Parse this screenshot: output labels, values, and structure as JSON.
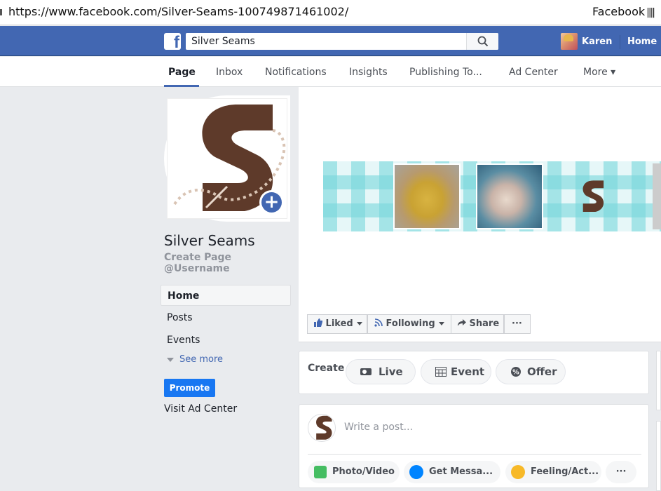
{
  "browser": {
    "url": "https://www.facebook.com/Silver-Seams-100749871461002/",
    "tab_title": "Facebook"
  },
  "topbar": {
    "logo_icon": "facebook-f-icon",
    "search_value": "Silver Seams",
    "search_icon": "search-icon",
    "user_name": "Karen",
    "home_label": "Home",
    "brand_color": "#4267b2"
  },
  "tabs": [
    {
      "label": "Page",
      "active": true
    },
    {
      "label": "Inbox"
    },
    {
      "label": "Notifications"
    },
    {
      "label": "Insights"
    },
    {
      "label": "Publishing To..."
    },
    {
      "label": "Ad Center"
    },
    {
      "label": "More ▾"
    }
  ],
  "profile": {
    "page_name": "Silver Seams",
    "create_username_line1": "Create Page",
    "create_username_line2": "@Username"
  },
  "left_nav": {
    "items": [
      "Home",
      "Posts",
      "Events"
    ],
    "see_more": "See more",
    "promote": "Promote",
    "visit_ad_center": "Visit Ad Center"
  },
  "cover_actions": {
    "liked": "Liked",
    "following": "Following",
    "share": "Share",
    "more": "···"
  },
  "create": {
    "label": "Create",
    "live": "Live",
    "event": "Event",
    "offer": "Offer"
  },
  "composer": {
    "placeholder": "Write a post...",
    "photo_video": "Photo/Video",
    "get_messages": "Get Messa...",
    "feeling": "Feeling/Act...",
    "more": "···"
  }
}
